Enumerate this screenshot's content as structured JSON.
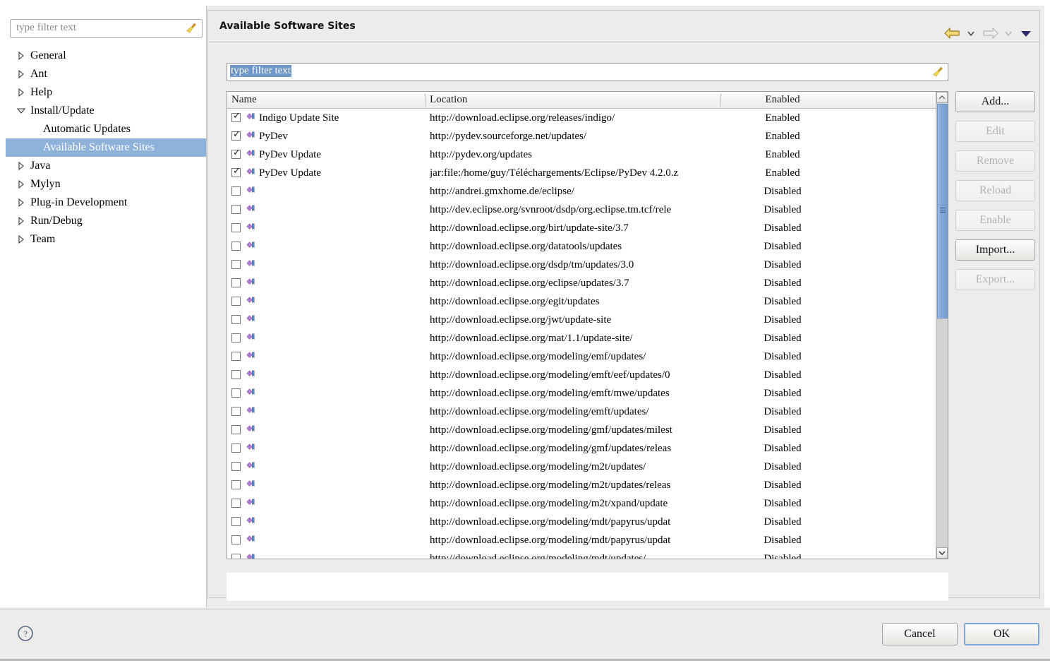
{
  "sidebar": {
    "filter": {
      "placeholder": "type filter text",
      "clear_icon": "broom-icon"
    },
    "items": [
      {
        "label": "General",
        "state": "collapsed",
        "level": 0
      },
      {
        "label": "Ant",
        "state": "collapsed",
        "level": 0
      },
      {
        "label": "Help",
        "state": "collapsed",
        "level": 0
      },
      {
        "label": "Install/Update",
        "state": "expanded",
        "level": 0
      },
      {
        "label": "Automatic Updates",
        "state": "leaf",
        "level": 1
      },
      {
        "label": "Available Software Sites",
        "state": "leaf",
        "level": 1,
        "selected": true
      },
      {
        "label": "Java",
        "state": "collapsed",
        "level": 0
      },
      {
        "label": "Mylyn",
        "state": "collapsed",
        "level": 0
      },
      {
        "label": "Plug-in Development",
        "state": "collapsed",
        "level": 0
      },
      {
        "label": "Run/Debug",
        "state": "collapsed",
        "level": 0
      },
      {
        "label": "Team",
        "state": "collapsed",
        "level": 0
      }
    ]
  },
  "pane": {
    "title": "Available Software Sites",
    "nav": {
      "back_icon": "back-arrow-icon",
      "back_menu_icon": "chevron-down-icon",
      "forward_icon": "forward-arrow-icon",
      "forward_menu_icon": "chevron-down-icon",
      "menu_icon": "dropdown-triangle-icon"
    },
    "filter": {
      "value": "type filter text",
      "selected": true,
      "clear_icon": "broom-icon"
    }
  },
  "table": {
    "columns": [
      "Name",
      "Location",
      "Enabled"
    ],
    "rows": [
      {
        "checked": true,
        "name": "Indigo Update Site",
        "location": "http://download.eclipse.org/releases/indigo/",
        "enabled": "Enabled"
      },
      {
        "checked": true,
        "name": "PyDev",
        "location": "http://pydev.sourceforge.net/updates/",
        "enabled": "Enabled"
      },
      {
        "checked": true,
        "name": "PyDev Update",
        "location": "http://pydev.org/updates",
        "enabled": "Enabled"
      },
      {
        "checked": true,
        "name": "PyDev Update",
        "location": "jar:file:/home/guy/Téléchargements/Eclipse/PyDev 4.2.0.z",
        "enabled": "Enabled"
      },
      {
        "checked": false,
        "name": "",
        "location": "http://andrei.gmxhome.de/eclipse/",
        "enabled": "Disabled"
      },
      {
        "checked": false,
        "name": "",
        "location": "http://dev.eclipse.org/svnroot/dsdp/org.eclipse.tm.tcf/rele",
        "enabled": "Disabled"
      },
      {
        "checked": false,
        "name": "",
        "location": "http://download.eclipse.org/birt/update-site/3.7",
        "enabled": "Disabled"
      },
      {
        "checked": false,
        "name": "",
        "location": "http://download.eclipse.org/datatools/updates",
        "enabled": "Disabled"
      },
      {
        "checked": false,
        "name": "",
        "location": "http://download.eclipse.org/dsdp/tm/updates/3.0",
        "enabled": "Disabled"
      },
      {
        "checked": false,
        "name": "",
        "location": "http://download.eclipse.org/eclipse/updates/3.7",
        "enabled": "Disabled"
      },
      {
        "checked": false,
        "name": "",
        "location": "http://download.eclipse.org/egit/updates",
        "enabled": "Disabled"
      },
      {
        "checked": false,
        "name": "",
        "location": "http://download.eclipse.org/jwt/update-site",
        "enabled": "Disabled"
      },
      {
        "checked": false,
        "name": "",
        "location": "http://download.eclipse.org/mat/1.1/update-site/",
        "enabled": "Disabled"
      },
      {
        "checked": false,
        "name": "",
        "location": "http://download.eclipse.org/modeling/emf/updates/",
        "enabled": "Disabled"
      },
      {
        "checked": false,
        "name": "",
        "location": "http://download.eclipse.org/modeling/emft/eef/updates/0",
        "enabled": "Disabled"
      },
      {
        "checked": false,
        "name": "",
        "location": "http://download.eclipse.org/modeling/emft/mwe/updates",
        "enabled": "Disabled"
      },
      {
        "checked": false,
        "name": "",
        "location": "http://download.eclipse.org/modeling/emft/updates/",
        "enabled": "Disabled"
      },
      {
        "checked": false,
        "name": "",
        "location": "http://download.eclipse.org/modeling/gmf/updates/milest",
        "enabled": "Disabled"
      },
      {
        "checked": false,
        "name": "",
        "location": "http://download.eclipse.org/modeling/gmf/updates/releas",
        "enabled": "Disabled"
      },
      {
        "checked": false,
        "name": "",
        "location": "http://download.eclipse.org/modeling/m2t/updates/",
        "enabled": "Disabled"
      },
      {
        "checked": false,
        "name": "",
        "location": "http://download.eclipse.org/modeling/m2t/updates/releas",
        "enabled": "Disabled"
      },
      {
        "checked": false,
        "name": "",
        "location": "http://download.eclipse.org/modeling/m2t/xpand/update",
        "enabled": "Disabled"
      },
      {
        "checked": false,
        "name": "",
        "location": "http://download.eclipse.org/modeling/mdt/papyrus/updat",
        "enabled": "Disabled"
      },
      {
        "checked": false,
        "name": "",
        "location": "http://download.eclipse.org/modeling/mdt/papyrus/updat",
        "enabled": "Disabled"
      },
      {
        "checked": false,
        "name": "",
        "location": "http://download.eclipse.org/modeling/mdt/updates/",
        "enabled": "Disabled"
      }
    ]
  },
  "side_buttons": [
    {
      "label": "Add...",
      "enabled": true
    },
    {
      "label": "Edit",
      "enabled": false
    },
    {
      "label": "Remove",
      "enabled": false
    },
    {
      "label": "Reload",
      "enabled": false
    },
    {
      "label": "Enable",
      "enabled": false
    },
    {
      "label": "Import...",
      "enabled": true
    },
    {
      "label": "Export...",
      "enabled": false
    }
  ],
  "footer": {
    "help_icon": "help-circle-icon",
    "cancel_label": "Cancel",
    "ok_label": "OK"
  },
  "colors": {
    "selection_blue": "#8fb2da",
    "scrollbar_thumb": "#7fa5d6",
    "dialog_bg": "#edecea",
    "focus_border": "#7ba7d7"
  }
}
